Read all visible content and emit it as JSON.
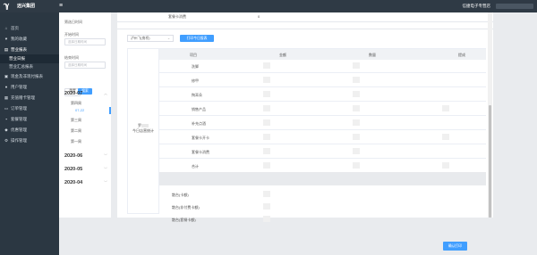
{
  "header": {
    "brand": "远兴集团",
    "user_name": "信捷电子专营店"
  },
  "sidebar": {
    "items": [
      {
        "icon": "home-icon",
        "label": "首页"
      },
      {
        "icon": "heart-icon",
        "label": "我的收藏"
      },
      {
        "icon": "chart-icon",
        "label": "营业报表"
      },
      {
        "icon": "",
        "label": "营业日报"
      },
      {
        "icon": "",
        "label": "营业汇总报表"
      },
      {
        "icon": "store-icon",
        "label": "现金及非现付报表"
      },
      {
        "icon": "user-icon",
        "label": "用户管理"
      },
      {
        "icon": "wallet-icon",
        "label": "充值赠卡管理"
      },
      {
        "icon": "order-icon",
        "label": "订单管理"
      },
      {
        "icon": "box-icon",
        "label": "套餐管理"
      },
      {
        "icon": "gift-icon",
        "label": "优惠管理"
      },
      {
        "icon": "settings-icon",
        "label": "操作管理"
      }
    ]
  },
  "date_panel": {
    "title": "筛选日时间",
    "start_label": "开始时间",
    "start_placeholder": "选择日期时间",
    "end_label": "结束时间",
    "end_placeholder": "选择日期时间",
    "reset_label": "重置",
    "search_label": "搜索",
    "months": [
      {
        "label": "2020-07",
        "expanded": true,
        "weeks": [
          "第四周",
          "07-22",
          "第三周",
          "第二周",
          "第一周"
        ]
      },
      {
        "label": "2020-06",
        "expanded": false
      },
      {
        "label": "2020-05",
        "expanded": false
      },
      {
        "label": "2020-04",
        "expanded": false
      }
    ]
  },
  "report": {
    "prev_row_label": "套餐卡消费",
    "prev_row_value": "0",
    "shop_select": "泸州飞(南桥)",
    "print_button": "打印今日报表",
    "left_label_prefix": "罗",
    "left_label_suffix": "今日店营统计",
    "columns": [
      "项目",
      "金额",
      "数量",
      "提成"
    ],
    "rows": [
      "洗脚",
      "修甲",
      "掏耳朵",
      "销售产品",
      "补充点酒",
      "套餐卡开卡",
      "套餐卡消费",
      "合计"
    ],
    "footer_rows": [
      "散台(卡额)",
      "散台(非付费卡额)",
      "散台(套餐卡额)"
    ]
  },
  "footer": {
    "ok_button": "确认打印"
  }
}
